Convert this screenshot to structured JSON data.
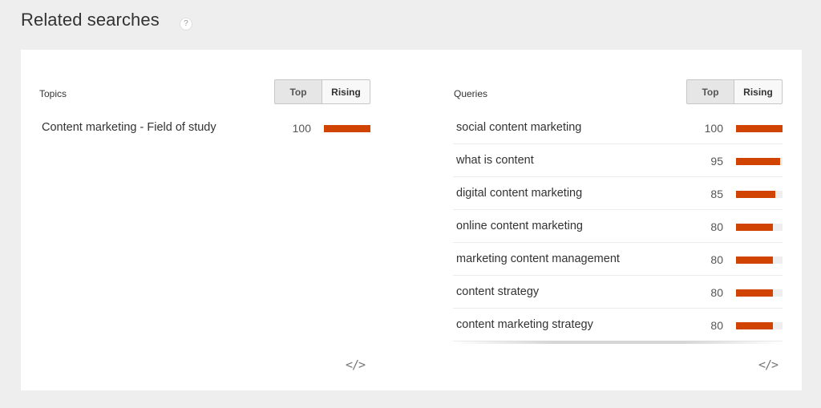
{
  "header": {
    "title": "Related searches",
    "help": "?"
  },
  "topics": {
    "label": "Topics",
    "toggle": {
      "top": "Top",
      "rising": "Rising"
    },
    "rows": [
      {
        "label": "Content marketing - Field of study",
        "value": "100",
        "pct": 100
      }
    ],
    "embed": "</>"
  },
  "queries": {
    "label": "Queries",
    "toggle": {
      "top": "Top",
      "rising": "Rising"
    },
    "rows": [
      {
        "label": "social content marketing",
        "value": "100",
        "pct": 100
      },
      {
        "label": "what is content",
        "value": "95",
        "pct": 95
      },
      {
        "label": "digital content marketing",
        "value": "85",
        "pct": 85
      },
      {
        "label": "online content marketing",
        "value": "80",
        "pct": 80
      },
      {
        "label": "marketing content management",
        "value": "80",
        "pct": 80
      },
      {
        "label": "content strategy",
        "value": "80",
        "pct": 80
      },
      {
        "label": "content marketing strategy",
        "value": "80",
        "pct": 80
      }
    ],
    "embed": "</>"
  },
  "colors": {
    "bar": "#d14300",
    "track": "#eeeeee"
  }
}
